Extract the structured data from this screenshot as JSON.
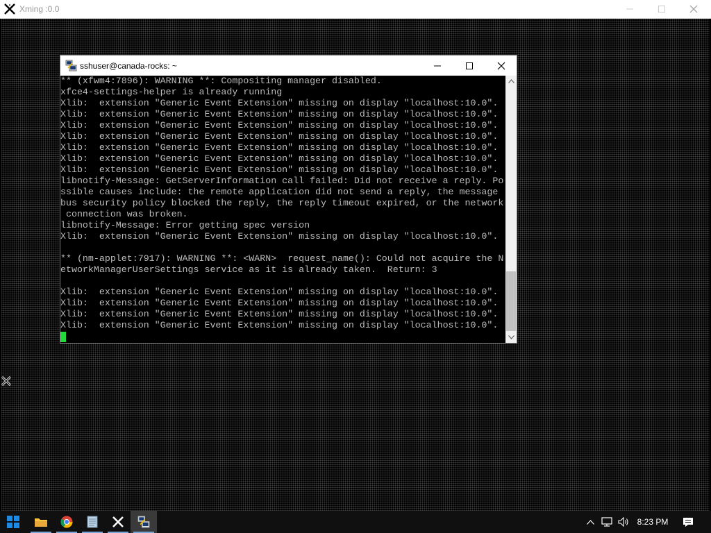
{
  "xming": {
    "title": "Xming :0.0"
  },
  "putty": {
    "title": "sshuser@canada-rocks: ~"
  },
  "terminal": {
    "lines": [
      "** (xfwm4:7896): WARNING **: Compositing manager disabled.",
      "xfce4-settings-helper is already running",
      "Xlib:  extension \"Generic Event Extension\" missing on display \"localhost:10.0\".",
      "Xlib:  extension \"Generic Event Extension\" missing on display \"localhost:10.0\".",
      "Xlib:  extension \"Generic Event Extension\" missing on display \"localhost:10.0\".",
      "Xlib:  extension \"Generic Event Extension\" missing on display \"localhost:10.0\".",
      "Xlib:  extension \"Generic Event Extension\" missing on display \"localhost:10.0\".",
      "Xlib:  extension \"Generic Event Extension\" missing on display \"localhost:10.0\".",
      "Xlib:  extension \"Generic Event Extension\" missing on display \"localhost:10.0\".",
      "libnotify-Message: GetServerInformation call failed: Did not receive a reply. Po",
      "ssible causes include: the remote application did not send a reply, the message",
      "bus security policy blocked the reply, the reply timeout expired, or the network",
      " connection was broken.",
      "libnotify-Message: Error getting spec version",
      "Xlib:  extension \"Generic Event Extension\" missing on display \"localhost:10.0\".",
      "",
      "** (nm-applet:7917): WARNING **: <WARN>  request_name(): Could not acquire the N",
      "etworkManagerUserSettings service as it is already taken.  Return: 3",
      "",
      "Xlib:  extension \"Generic Event Extension\" missing on display \"localhost:10.0\".",
      "Xlib:  extension \"Generic Event Extension\" missing on display \"localhost:10.0\".",
      "Xlib:  extension \"Generic Event Extension\" missing on display \"localhost:10.0\".",
      "Xlib:  extension \"Generic Event Extension\" missing on display \"localhost:10.0\".",
      ""
    ]
  },
  "taskbar": {
    "apps": [
      {
        "name": "start-icon"
      },
      {
        "name": "file-explorer-icon"
      },
      {
        "name": "chrome-icon"
      },
      {
        "name": "notepad-icon"
      },
      {
        "name": "xming-icon"
      },
      {
        "name": "putty-icon"
      }
    ],
    "clock": "8:23 PM"
  },
  "colors": {
    "terminal_bg": "#000000",
    "terminal_fg": "#bbbbbb",
    "cursor": "#22d83a",
    "taskbar_bg": "#101010"
  }
}
